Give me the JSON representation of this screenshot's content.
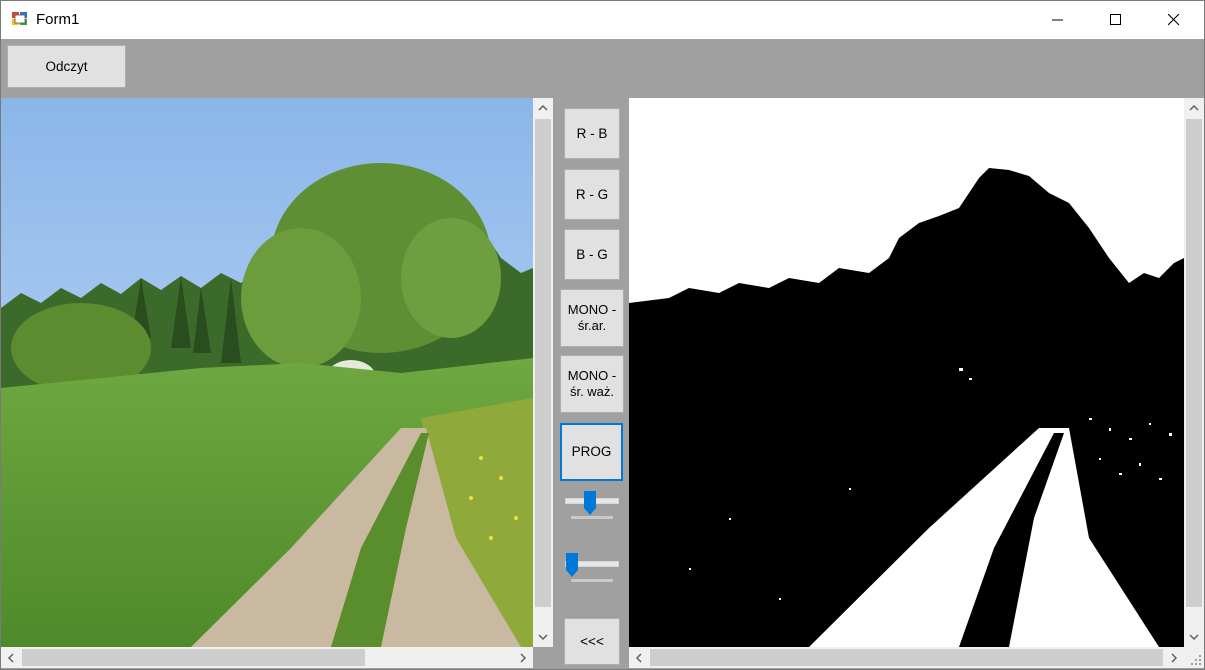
{
  "window": {
    "title": "Form1"
  },
  "toolbar": {
    "read_button": "Odczyt"
  },
  "side_buttons": [
    {
      "label": "R - B"
    },
    {
      "label": "R - G"
    },
    {
      "label": "B - G"
    },
    {
      "label": "MONO -\nśr.ar."
    },
    {
      "label": "MONO -\nśr. waż."
    },
    {
      "label": "PROG"
    }
  ],
  "back_button": "<<<",
  "sliders": {
    "threshold_level": 0.45,
    "second_level": 0.0
  },
  "colors": {
    "accent": "#0078d7",
    "form_bg": "#a0a0a0",
    "button_bg": "#e1e1e1"
  }
}
